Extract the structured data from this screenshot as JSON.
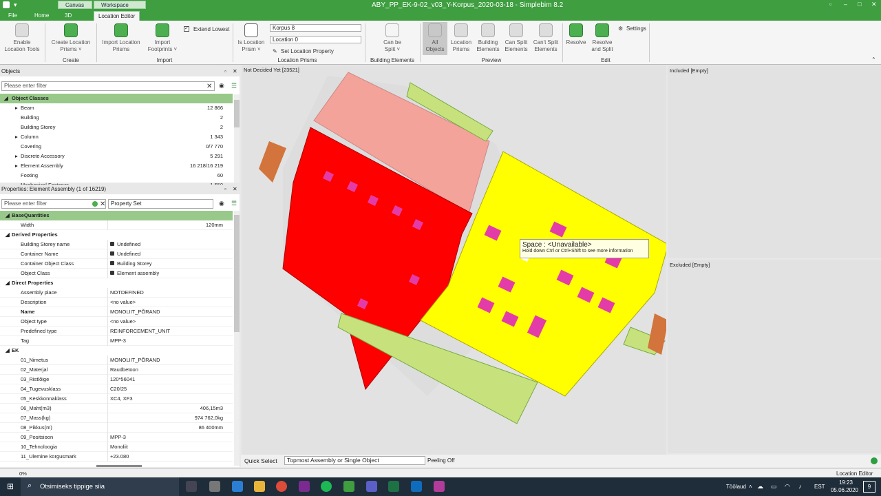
{
  "window": {
    "title": "ABY_PP_EK-9-02_v03_Y-Korpus_2020-03-18 - Simplebim 8.2",
    "context_tabs": [
      "Canvas",
      "Workspace"
    ]
  },
  "tabs": [
    "File",
    "Home",
    "3D",
    "Location Editor"
  ],
  "ribbon": {
    "enable_location_tools": "Enable\nLocation Tools",
    "create_location_prisms": "Create Location\nPrisms ˅",
    "group_create": "Create",
    "import_location_prisms": "Import Location\nPrisms",
    "import_footprints": "Import\nFootprints ˅",
    "group_import": "Import",
    "extend_lowest": "Extend Lowest",
    "is_location_prism": "Is Location\nPrism ˅",
    "korpus_field": "Korpus 8",
    "location_field": "Location 0",
    "set_location_property": "Set Location Property",
    "group_location_prisms": "Location Prisms",
    "can_be_split": "Can be\nSplit ˅",
    "group_building_elements": "Building Elements",
    "all_objects": "All\nObjects",
    "location_prisms": "Location\nPrisms",
    "building_elements": "Building\nElements",
    "can_split_elements": "Can Split\nElements",
    "cant_split_elements": "Can't Split\nElements",
    "group_preview": "Preview",
    "resolve": "Resolve",
    "resolve_and_split": "Resolve\nand Split",
    "settings": "Settings",
    "group_edit": "Edit"
  },
  "objects_panel": {
    "title": "Objects",
    "filter_placeholder": "Please enter filter",
    "header": "Object Classes",
    "rows": [
      [
        "Beam",
        "12 866"
      ],
      [
        "Building",
        "2"
      ],
      [
        "Building Storey",
        "2"
      ],
      [
        "Column",
        "1 343"
      ],
      [
        "Covering",
        "0/7 770"
      ],
      [
        "Discrete Accessory",
        "5 291"
      ],
      [
        "Element Assembly",
        "16 218/16 219"
      ],
      [
        "Footing",
        "60"
      ],
      [
        "Mechanical Fastener",
        "1 550"
      ]
    ]
  },
  "props_panel": {
    "title": "Properties: Element Assembly (1 of 16219)",
    "filter_placeholder": "Please enter filter",
    "property_set": "Property Set",
    "groups": [
      {
        "name": "BaseQuantities",
        "rows": [
          [
            "Width",
            "",
            "120mm"
          ]
        ]
      },
      {
        "name": "Derived Properties",
        "rows": [
          [
            "Building Storey name",
            "Undefined",
            ""
          ],
          [
            "Container Name",
            "Undefined",
            ""
          ],
          [
            "Container Object Class",
            "Building Storey",
            ""
          ],
          [
            "Object Class",
            "Element assembly",
            ""
          ]
        ]
      },
      {
        "name": "Direct Properties",
        "rows": [
          [
            "Assembly place",
            "NOTDEFINED",
            ""
          ],
          [
            "Description",
            "<no value>",
            ""
          ],
          [
            "Name",
            "MONOLIIT_PÕRAND",
            ""
          ],
          [
            "Object type",
            "<no value>",
            ""
          ],
          [
            "Predefined type",
            "REINFORCEMENT_UNIT",
            ""
          ],
          [
            "Tag",
            "MPP-3",
            ""
          ]
        ]
      },
      {
        "name": "EK",
        "rows": [
          [
            "01_Nimetus",
            "MONOLIIT_PÕRAND",
            ""
          ],
          [
            "02_Materjal",
            "Raudbetoon",
            ""
          ],
          [
            "03_Ristlõige",
            "120*56041",
            ""
          ],
          [
            "04_Tugevusklass",
            "C20/25",
            ""
          ],
          [
            "05_Keskkonnaklass",
            "XC4, XF3",
            ""
          ],
          [
            "06_Maht(m3)",
            "",
            "406,15m3"
          ],
          [
            "07_Mass(kg)",
            "",
            "974 762,0kg"
          ],
          [
            "08_Pikkus(m)",
            "",
            "86 400mm"
          ],
          [
            "09_Positsioon",
            "MPP-3",
            ""
          ],
          [
            "10_Tehnoloogia",
            "Monoliit",
            ""
          ],
          [
            "11_Ulemine korgusmark",
            "+23.080",
            ""
          ]
        ]
      }
    ]
  },
  "viewport": {
    "title": "Not Decided Yet [23521]",
    "tooltip_title": "Space : <Unavailable>",
    "tooltip_hint": "Hold down Ctrl or Ctrl+Shift to see more information"
  },
  "included": {
    "title": "Included [Empty]"
  },
  "excluded": {
    "title": "Excluded [Empty]"
  },
  "bottom": {
    "quick_select_label": "Quick Select",
    "quick_select_value": "Topmost Assembly or Single Object",
    "peeling": "Peeling Off"
  },
  "status": {
    "progress": "0%",
    "mode": "Location Editor"
  },
  "taskbar": {
    "search": "Otsimiseks tippige siia",
    "desktop": "Töölaud",
    "lang": "EST",
    "time": "19:23",
    "date": "05.06.2020",
    "notif": "9"
  }
}
